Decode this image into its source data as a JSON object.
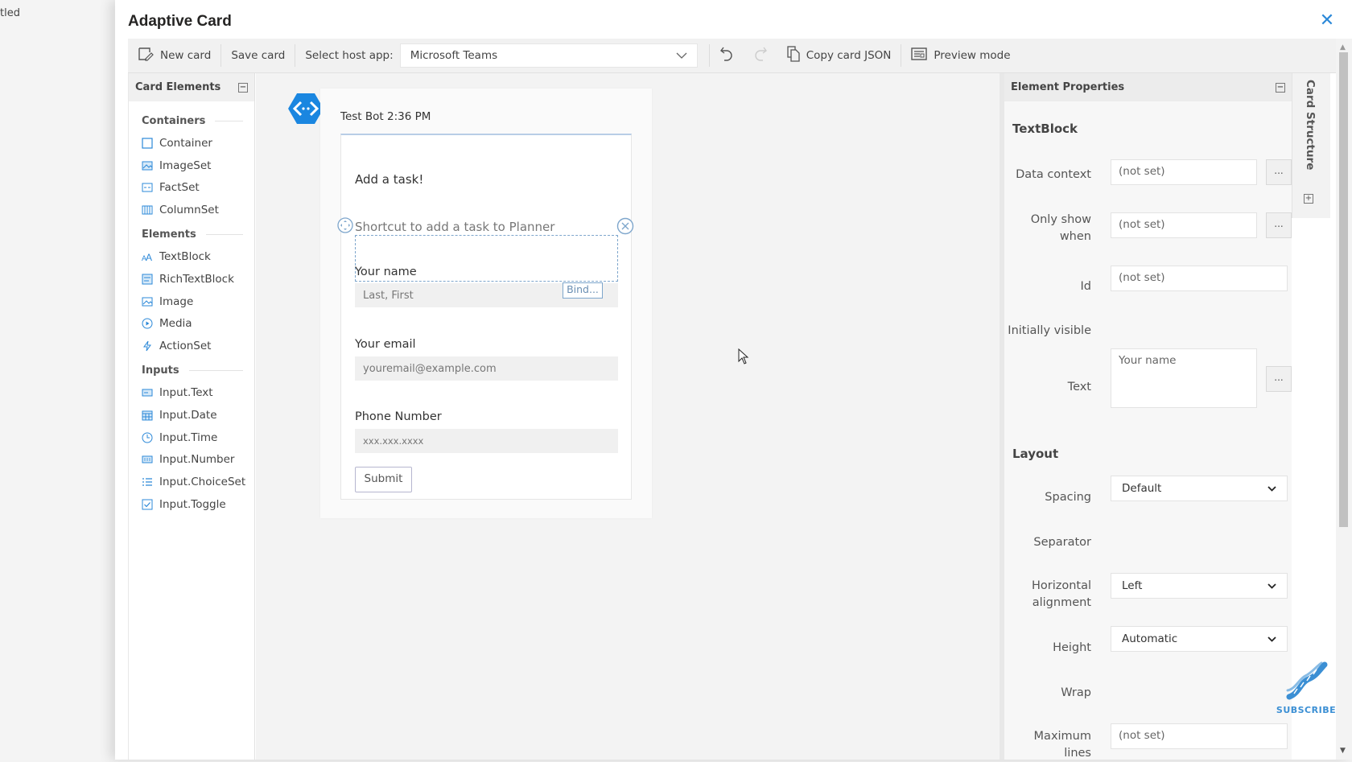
{
  "background_window": {
    "title_fragment": "tled"
  },
  "dialog": {
    "title": "Adaptive Card",
    "close_icon": "close-icon"
  },
  "toolbar": {
    "new_card": "New card",
    "save_card": "Save card",
    "host_app_label": "Select host app:",
    "host_app_value": "Microsoft Teams",
    "copy_json": "Copy card JSON",
    "preview_mode": "Preview mode",
    "icons": [
      "new-card-icon",
      "undo-icon",
      "redo-icon",
      "copy-icon",
      "preview-icon"
    ]
  },
  "card_elements": {
    "title": "Card Elements",
    "groups": [
      {
        "name": "Containers",
        "items": [
          {
            "label": "Container",
            "icon": "container-icon"
          },
          {
            "label": "ImageSet",
            "icon": "imageset-icon"
          },
          {
            "label": "FactSet",
            "icon": "factset-icon"
          },
          {
            "label": "ColumnSet",
            "icon": "columnset-icon"
          }
        ]
      },
      {
        "name": "Elements",
        "items": [
          {
            "label": "TextBlock",
            "icon": "textblock-icon"
          },
          {
            "label": "RichTextBlock",
            "icon": "richtextblock-icon"
          },
          {
            "label": "Image",
            "icon": "image-icon"
          },
          {
            "label": "Media",
            "icon": "media-icon"
          },
          {
            "label": "ActionSet",
            "icon": "actionset-icon"
          }
        ]
      },
      {
        "name": "Inputs",
        "items": [
          {
            "label": "Input.Text",
            "icon": "input-text-icon"
          },
          {
            "label": "Input.Date",
            "icon": "input-date-icon"
          },
          {
            "label": "Input.Time",
            "icon": "input-time-icon"
          },
          {
            "label": "Input.Number",
            "icon": "input-number-icon"
          },
          {
            "label": "Input.ChoiceSet",
            "icon": "input-choiceset-icon"
          },
          {
            "label": "Input.Toggle",
            "icon": "input-toggle-icon"
          }
        ]
      }
    ]
  },
  "preview": {
    "bot_header": "Test Bot 2:36 PM",
    "card": {
      "title": "Add a task!",
      "subtitle": "Shortcut to add a task to Planner",
      "name_label": "Your name",
      "name_placeholder": "Last, First",
      "bind_label": "Bind...",
      "email_label": "Your email",
      "email_placeholder": "youremail@example.com",
      "phone_label": "Phone Number",
      "phone_placeholder": "xxx.xxx.xxxx",
      "submit_label": "Submit"
    }
  },
  "properties": {
    "title": "Element Properties",
    "element_type": "TextBlock",
    "data_context_label": "Data context",
    "data_context_value": "(not set)",
    "only_show_when_label_1": "Only show",
    "only_show_when_label_2": "when",
    "only_show_when_value": "(not set)",
    "id_label": "Id",
    "id_value": "(not set)",
    "initially_visible_label": "Initially visible",
    "text_label": "Text",
    "text_value": "Your name",
    "ellipsis": "...",
    "layout_section": "Layout",
    "spacing_label": "Spacing",
    "spacing_value": "Default",
    "separator_label": "Separator",
    "halign_label_1": "Horizontal",
    "halign_label_2": "alignment",
    "halign_value": "Left",
    "height_label": "Height",
    "height_value": "Automatic",
    "wrap_label": "Wrap",
    "max_lines_label_1": "Maximum",
    "max_lines_label_2": "lines",
    "max_lines_value": "(not set)"
  },
  "card_structure": {
    "label": "Card Structure"
  },
  "watermark": {
    "label": "SUBSCRIBE",
    "color": "#3b8fd4"
  },
  "colors": {
    "accent": "#2b88d8",
    "selection": "#7ea6cc"
  }
}
